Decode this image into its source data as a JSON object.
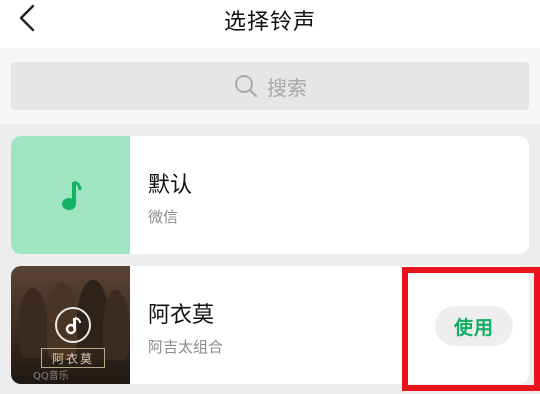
{
  "header": {
    "title": "选择铃声",
    "back_icon": "chevron-left-icon"
  },
  "search": {
    "placeholder": "搜索",
    "icon": "search-icon"
  },
  "ringtones": [
    {
      "name": "默认",
      "artist": "微信",
      "thumb_icon": "music-note-icon",
      "thumb_color": "#9fe5c2",
      "note_color": "#13b463"
    },
    {
      "name": "阿衣莫",
      "artist": "阿吉太组合",
      "album_title": "阿衣莫",
      "watermark": "QQ音乐",
      "badge_icon": "play-note-icon",
      "action_label": "使用"
    }
  ],
  "colors": {
    "accent": "#0fae60",
    "highlight": "#e8141b"
  }
}
